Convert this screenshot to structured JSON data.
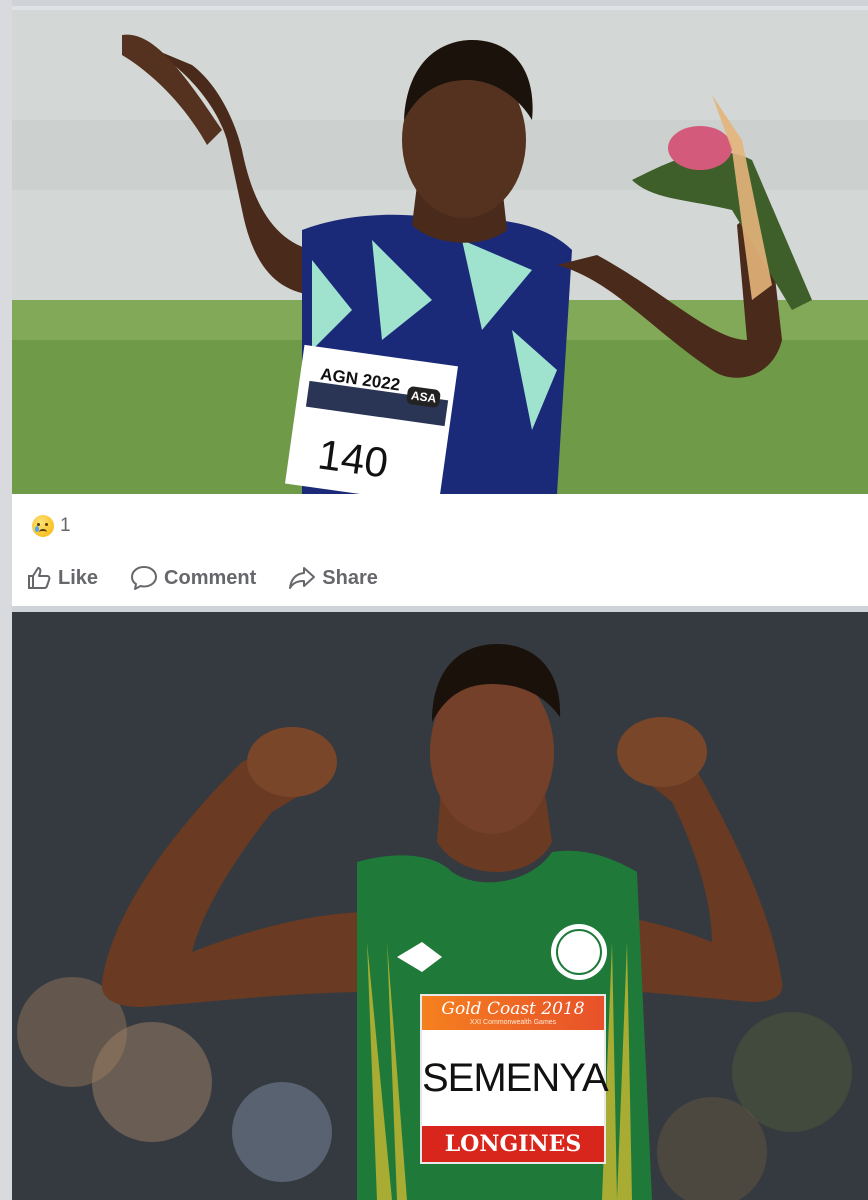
{
  "post": {
    "photo_top_alt_icon": "photo",
    "bib_top": {
      "line1": "AGN 2022",
      "logo": "ASA",
      "number": "140"
    },
    "reactions": {
      "icon": "sad-reaction-icon",
      "count": "1"
    },
    "actions": [
      {
        "label": "Like",
        "icon": "like-icon"
      },
      {
        "label": "Comment",
        "icon": "comment-icon"
      },
      {
        "label": "Share",
        "icon": "share-icon"
      }
    ]
  },
  "photo2": {
    "bib": {
      "event": "Gold Coast 2018",
      "subtitle": "XXI Commonwealth Games",
      "name": "SEMENYA",
      "sponsor": "LONGINES"
    }
  },
  "colors": {
    "muted_text": "#65676b",
    "card_bg": "#ffffff",
    "page_bg": "#dfe1e5",
    "jersey_green": "#1f7a3a",
    "bib_orange": "#f07f22",
    "bib_red": "#d9261c"
  }
}
